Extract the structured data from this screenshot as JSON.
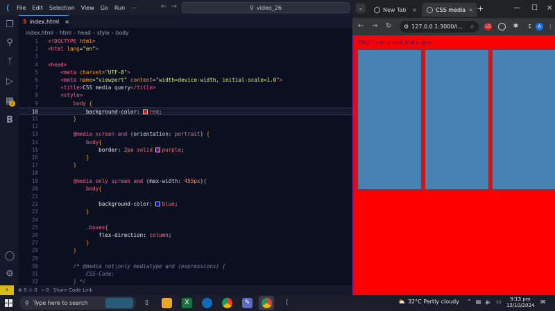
{
  "vscode": {
    "menu": [
      "File",
      "Edit",
      "Selection",
      "View",
      "Go",
      "Run",
      "⋯"
    ],
    "command_center": "video_26",
    "tab": "index.html",
    "breadcrumb": [
      "index.html",
      "html",
      "head",
      "style",
      "body"
    ],
    "statusbar": {
      "errors": "⊗ 0 ⚠ 0",
      "ports": "⑂ 0",
      "share": "Share Code Link"
    },
    "activity_badge": "1",
    "lines": [
      {
        "n": "1",
        "html": "<span class='t-tag'>&lt;!DOCTYPE </span><span class='t-attr'>html</span><span class='t-tag'>&gt;</span>"
      },
      {
        "n": "2",
        "html": "<span class='t-tag'>&lt;html </span><span class='t-attr'>lang</span><span class='t-txt'>=</span><span class='t-str'>\"en\"</span><span class='t-tag'>&gt;</span>"
      },
      {
        "n": "3",
        "html": ""
      },
      {
        "n": "4",
        "html": "<span class='t-tag'>&lt;head&gt;</span>"
      },
      {
        "n": "5",
        "html": "    <span class='t-tag'>&lt;meta </span><span class='t-attr'>charset</span><span class='t-txt'>=</span><span class='t-str'>\"UTF-8\"</span><span class='t-tag'>&gt;</span>"
      },
      {
        "n": "6",
        "html": "    <span class='t-tag'>&lt;meta </span><span class='t-attr'>name</span><span class='t-txt'>=</span><span class='t-str'>\"viewport\" </span><span class='t-attr'>content</span><span class='t-txt'>=</span><span class='t-str'>\"width=device-width, initial-scale=1.0\"</span><span class='t-tag'>&gt;</span>"
      },
      {
        "n": "7",
        "html": "    <span class='t-tag'>&lt;title&gt;</span><span class='t-txt'>CSS media query</span><span class='t-tag'>&lt;/title&gt;</span>"
      },
      {
        "n": "8",
        "html": "    <span class='t-tag'>&lt;style&gt;</span>"
      },
      {
        "n": "9",
        "html": "        <span class='t-sel'>body </span><span class='t-punc'>{</span>"
      },
      {
        "n": "10",
        "html": "            <span class='t-prop'>background-color: </span><span class='swatch' style='background:#ff0000'></span><span class='t-val'>red</span><span class='t-txt'>;</span>",
        "active": true
      },
      {
        "n": "11",
        "html": "        <span class='t-punc'>}</span>"
      },
      {
        "n": "12",
        "html": ""
      },
      {
        "n": "13",
        "html": "        <span class='t-kw'>@media </span><span class='t-sel'>screen </span><span class='t-kw'>and </span><span class='t-txt'>(orientation: </span><span class='t-val'>portrait</span><span class='t-txt'>) </span><span class='t-punc'>{</span>"
      },
      {
        "n": "14",
        "html": "            <span class='t-sel'>body</span><span class='t-punc'>{</span>"
      },
      {
        "n": "15",
        "html": "                <span class='t-prop'>border: </span><span class='t-num'>2px </span><span class='t-val'>solid </span><span class='swatch' style='background:#800080'></span><span class='t-val'>purple</span><span class='t-txt'>;</span>"
      },
      {
        "n": "16",
        "html": "            <span class='t-punc'>}</span>"
      },
      {
        "n": "17",
        "html": "        <span class='t-punc'>}</span>"
      },
      {
        "n": "18",
        "html": ""
      },
      {
        "n": "19",
        "html": "        <span class='t-kw'>@media </span><span class='t-sel'>only screen </span><span class='t-kw'>and </span><span class='t-txt'>(max-width: </span><span class='t-num'>455px</span><span class='t-txt'>)</span><span class='t-punc'>{</span>"
      },
      {
        "n": "20",
        "html": "            <span class='t-sel'>body</span><span class='t-punc'>{</span>"
      },
      {
        "n": "21",
        "html": ""
      },
      {
        "n": "22",
        "html": "                <span class='t-prop'>background-color: </span><span class='swatch' style='background:#0000ff'></span><span class='t-val'>blue</span><span class='t-txt'>;</span>"
      },
      {
        "n": "23",
        "html": "            <span class='t-punc'>}</span>"
      },
      {
        "n": "24",
        "html": ""
      },
      {
        "n": "25",
        "html": "            <span class='t-sel'>.boxes</span><span class='t-punc'>{</span>"
      },
      {
        "n": "26",
        "html": "                <span class='t-prop'>flex-direction: </span><span class='t-val'>column</span><span class='t-txt'>;</span>"
      },
      {
        "n": "27",
        "html": "            <span class='t-punc'>}</span>"
      },
      {
        "n": "28",
        "html": "        <span class='t-punc'>}</span>"
      },
      {
        "n": "29",
        "html": ""
      },
      {
        "n": "30",
        "html": "        <span class='t-cmt'>/* @media not|only mediatype and (expressions) {</span>"
      },
      {
        "n": "31",
        "html": "            <span class='t-cmt'>CSS-Code;</span>"
      },
      {
        "n": "32",
        "html": "        <span class='t-cmt'>} */</span>"
      }
    ]
  },
  "browser": {
    "tab1": "New Tab",
    "tab2": "CSS media",
    "url": "127.0.0.1:3000/i...",
    "page_text": "Hey I am a red body guy!",
    "extension_1": "LD",
    "profile": "A"
  },
  "taskbar": {
    "search_placeholder": "Type here to search",
    "weather": "32°C  Partly cloudy",
    "time": "9:13 pm",
    "date": "15/10/2024"
  }
}
